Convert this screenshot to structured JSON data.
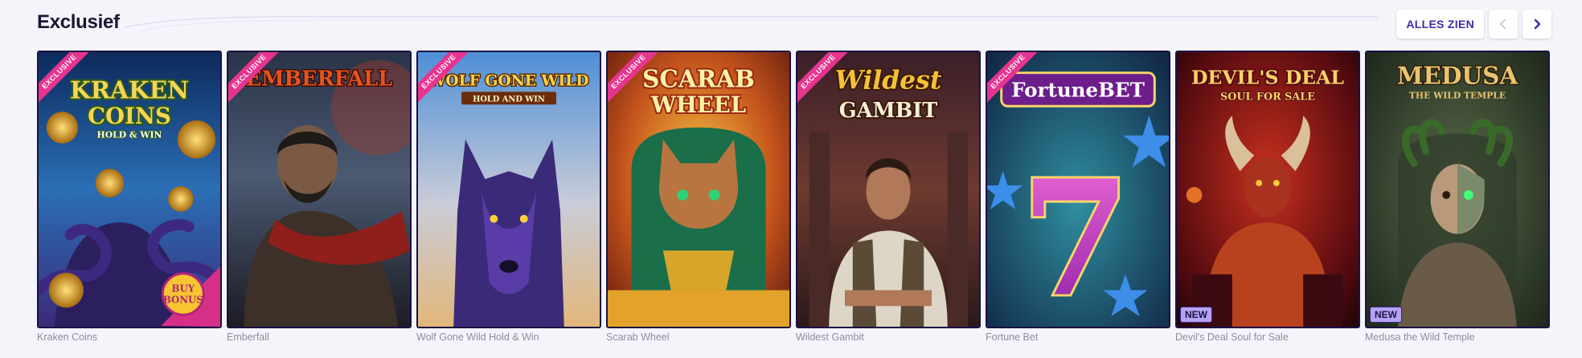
{
  "section": {
    "title": "Exclusief",
    "view_all_label": "ALLES ZIEN"
  },
  "icons": {
    "prev": "chevron-left-icon",
    "next": "chevron-right-icon"
  },
  "colors": {
    "accent": "#3a2fa8",
    "exclusive_ribbon": "#e6348f",
    "new_badge": "#b6a3f5",
    "tile_border": "#1b1244"
  },
  "games": [
    {
      "title": "Kraken Coins",
      "exclusive": true,
      "new": false,
      "exclusive_label": "EXCLUSIVE",
      "logo": [
        "KRAKEN",
        "COINS"
      ],
      "logo_sub": "HOLD & WIN",
      "sticker": [
        "BUY",
        "BONUS"
      ]
    },
    {
      "title": "Emberfall",
      "exclusive": true,
      "new": false,
      "exclusive_label": "EXCLUSIVE",
      "logo": [
        "EMBERFALL"
      ]
    },
    {
      "title": "Wolf Gone Wild Hold & Win",
      "exclusive": true,
      "new": false,
      "exclusive_label": "EXCLUSIVE",
      "logo": [
        "WOLF GONE WILD"
      ],
      "logo_sub": "HOLD AND WIN"
    },
    {
      "title": "Scarab Wheel",
      "exclusive": true,
      "new": false,
      "exclusive_label": "EXCLUSIVE",
      "logo": [
        "SCARAB",
        "WHEEL"
      ]
    },
    {
      "title": "Wildest Gambit",
      "exclusive": true,
      "new": false,
      "exclusive_label": "EXCLUSIVE",
      "logo": [
        "Wildest",
        "GAMBIT"
      ]
    },
    {
      "title": "Fortune Bet",
      "exclusive": true,
      "new": false,
      "exclusive_label": "EXCLUSIVE",
      "logo": [
        "FortuneBET"
      ],
      "big_symbol": "7"
    },
    {
      "title": "Devil's Deal Soul for Sale",
      "exclusive": false,
      "new": true,
      "new_label": "NEW",
      "logo": [
        "DEVIL'S DEAL"
      ],
      "logo_sub": "SOUL FOR SALE"
    },
    {
      "title": "Medusa the Wild Temple",
      "exclusive": false,
      "new": true,
      "new_label": "NEW",
      "logo": [
        "MEDUSA"
      ],
      "logo_sub": "THE WILD TEMPLE"
    }
  ]
}
